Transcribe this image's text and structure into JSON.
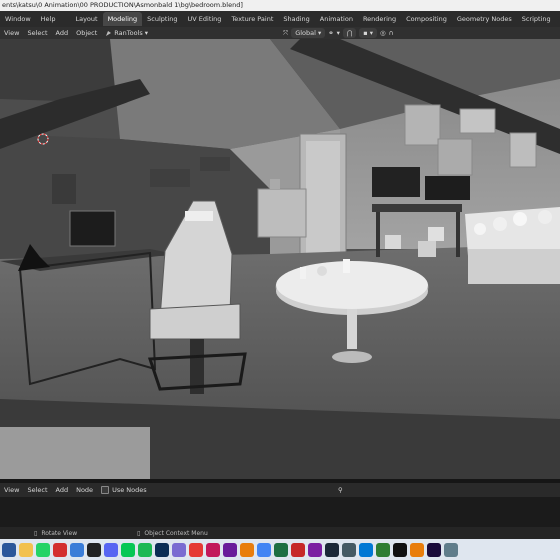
{
  "window": {
    "path": "ents\\katsu\\0 Animation\\00 PRODUCTION\\Asmonbald 1\\bg\\bedroom.blend]"
  },
  "menubar": {
    "items": [
      "Window",
      "Help"
    ],
    "tabs": [
      "Layout",
      "Modeling",
      "Sculpting",
      "UV Editing",
      "Texture Paint",
      "Shading",
      "Animation",
      "Rendering",
      "Compositing",
      "Geometry Nodes",
      "Scripting"
    ],
    "active_tab": "Modeling",
    "add_tab": "+"
  },
  "viewport_header": {
    "items": [
      "View",
      "Select",
      "Add",
      "Object"
    ],
    "addon": "RanTools",
    "orientation": "Global"
  },
  "node_editor_header": {
    "items": [
      "View",
      "Select",
      "Add",
      "Node"
    ],
    "use_nodes_label": "Use Nodes",
    "use_nodes_checked": false
  },
  "status_bar": {
    "left_action": "Rotate View",
    "right_action": "Object Context Menu"
  },
  "taskbar": {
    "icons": [
      {
        "name": "start-icon",
        "color": "#2b579a"
      },
      {
        "name": "folder-icon",
        "color": "#f2c14e"
      },
      {
        "name": "whatsapp-icon",
        "color": "#25d366"
      },
      {
        "name": "opera-icon",
        "color": "#d32f2f"
      },
      {
        "name": "file-explorer-icon",
        "color": "#3b7dd8"
      },
      {
        "name": "notion-icon",
        "color": "#222222"
      },
      {
        "name": "discord-icon",
        "color": "#5865f2"
      },
      {
        "name": "line-icon",
        "color": "#06c755"
      },
      {
        "name": "spotify-icon",
        "color": "#1db954"
      },
      {
        "name": "photoshop-icon",
        "color": "#0b2d55"
      },
      {
        "name": "after-effects-icon",
        "color": "#7a6bd1"
      },
      {
        "name": "youtube-music-icon",
        "color": "#e53935"
      },
      {
        "name": "music-icon",
        "color": "#c2185b"
      },
      {
        "name": "circle-app-icon",
        "color": "#6a1b9a"
      },
      {
        "name": "blender-icon",
        "color": "#e87d0d"
      },
      {
        "name": "chrome-icon",
        "color": "#4285f4"
      },
      {
        "name": "excel-icon",
        "color": "#1d6f42"
      },
      {
        "name": "red-app-icon",
        "color": "#c62828"
      },
      {
        "name": "purple-app-icon",
        "color": "#7b1fa2"
      },
      {
        "name": "steam-icon",
        "color": "#1b2838"
      },
      {
        "name": "media-icon",
        "color": "#455a64"
      },
      {
        "name": "photos-icon",
        "color": "#0078d4"
      },
      {
        "name": "image-viewer-icon",
        "color": "#2e7d32"
      },
      {
        "name": "capcut-icon",
        "color": "#111111"
      },
      {
        "name": "blender-active-icon",
        "color": "#e87d0d"
      },
      {
        "name": "after-effects-2-icon",
        "color": "#1a0b3b"
      },
      {
        "name": "extra-icon",
        "color": "#607d8b"
      }
    ]
  }
}
